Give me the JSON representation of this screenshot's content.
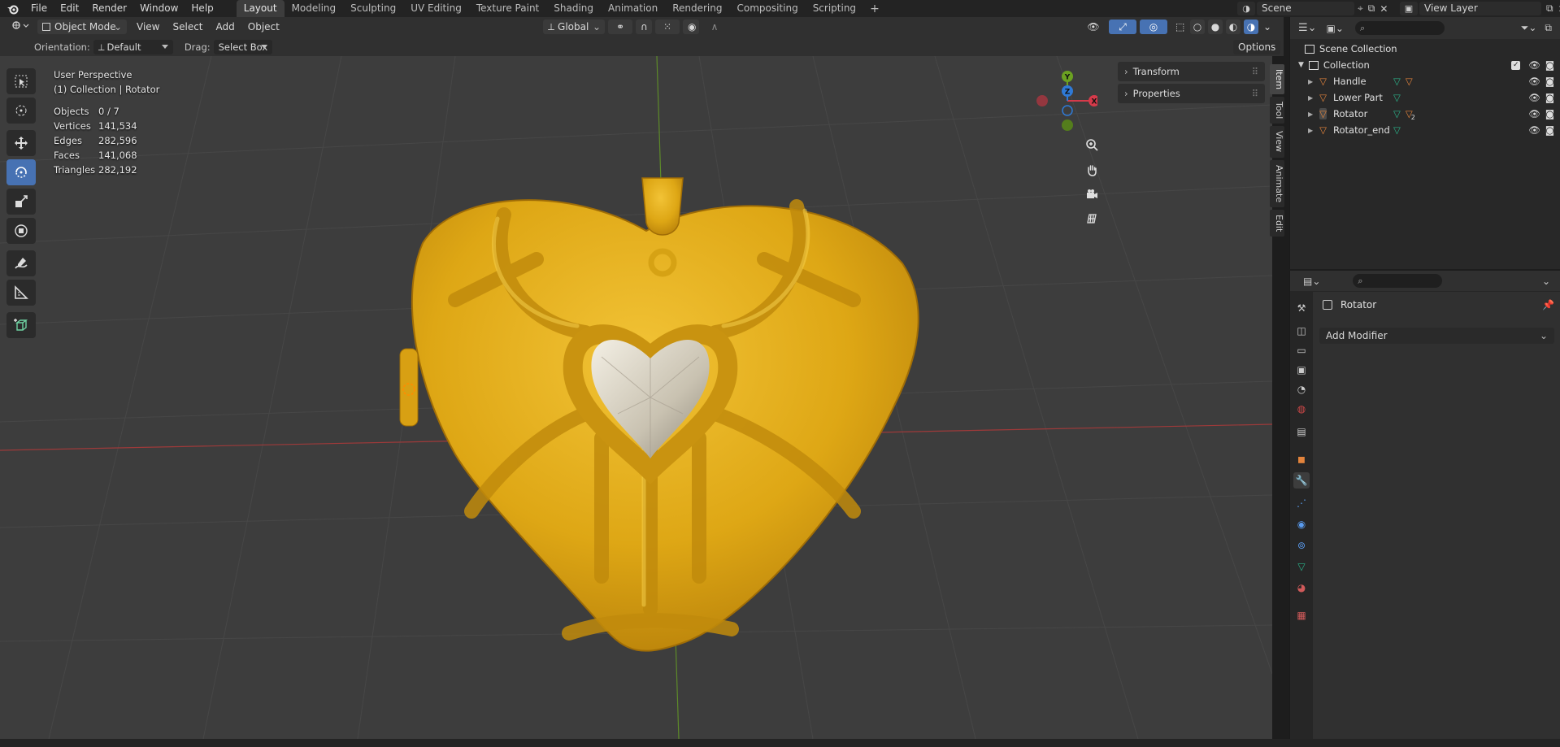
{
  "topbar": {
    "menus": [
      "File",
      "Edit",
      "Render",
      "Window",
      "Help"
    ],
    "workspaces": [
      "Layout",
      "Modeling",
      "Sculpting",
      "UV Editing",
      "Texture Paint",
      "Shading",
      "Animation",
      "Rendering",
      "Compositing",
      "Scripting"
    ],
    "active_workspace": "Layout",
    "scene_label": "Scene",
    "view_layer_label": "View Layer"
  },
  "viewport_header": {
    "mode": "Object Mode",
    "menus": [
      "View",
      "Select",
      "Add",
      "Object"
    ],
    "transform_orientation": "Global",
    "orientation_label": "Orientation:",
    "orientation_value": "Default",
    "drag_label": "Drag:",
    "drag_value": "Select Box",
    "options_label": "Options"
  },
  "viewport": {
    "perspective": "User Perspective",
    "context": "(1) Collection | Rotator",
    "stats": [
      {
        "label": "Objects",
        "value": "0 / 7"
      },
      {
        "label": "Vertices",
        "value": "141,534"
      },
      {
        "label": "Edges",
        "value": "282,596"
      },
      {
        "label": "Faces",
        "value": "141,068"
      },
      {
        "label": "Triangles",
        "value": "282,192"
      }
    ],
    "gizmo_axes": {
      "x": "X",
      "y": "Y",
      "z": "Z"
    }
  },
  "npanel": {
    "sections": [
      "Transform",
      "Properties"
    ],
    "tabs": [
      "Item",
      "Tool",
      "View",
      "Animate",
      "Edit"
    ],
    "active_tab": "Item"
  },
  "outliner": {
    "root": "Scene Collection",
    "collection": "Collection",
    "items": [
      {
        "name": "Handle",
        "modifier_badge": ""
      },
      {
        "name": "Lower Part",
        "modifier_badge": ""
      },
      {
        "name": "Rotator",
        "modifier_badge": "2"
      },
      {
        "name": "Rotator_end",
        "modifier_badge": ""
      }
    ]
  },
  "properties": {
    "object_name": "Rotator",
    "add_modifier_label": "Add Modifier"
  },
  "colors": {
    "accent": "#4772b3",
    "gold": "#e8b414",
    "axis_x": "#d63a4a",
    "axis_y": "#6ba121",
    "axis_z": "#2f7ad6",
    "mesh_icon": "#e3843c",
    "data_icon": "#2bb38a"
  }
}
